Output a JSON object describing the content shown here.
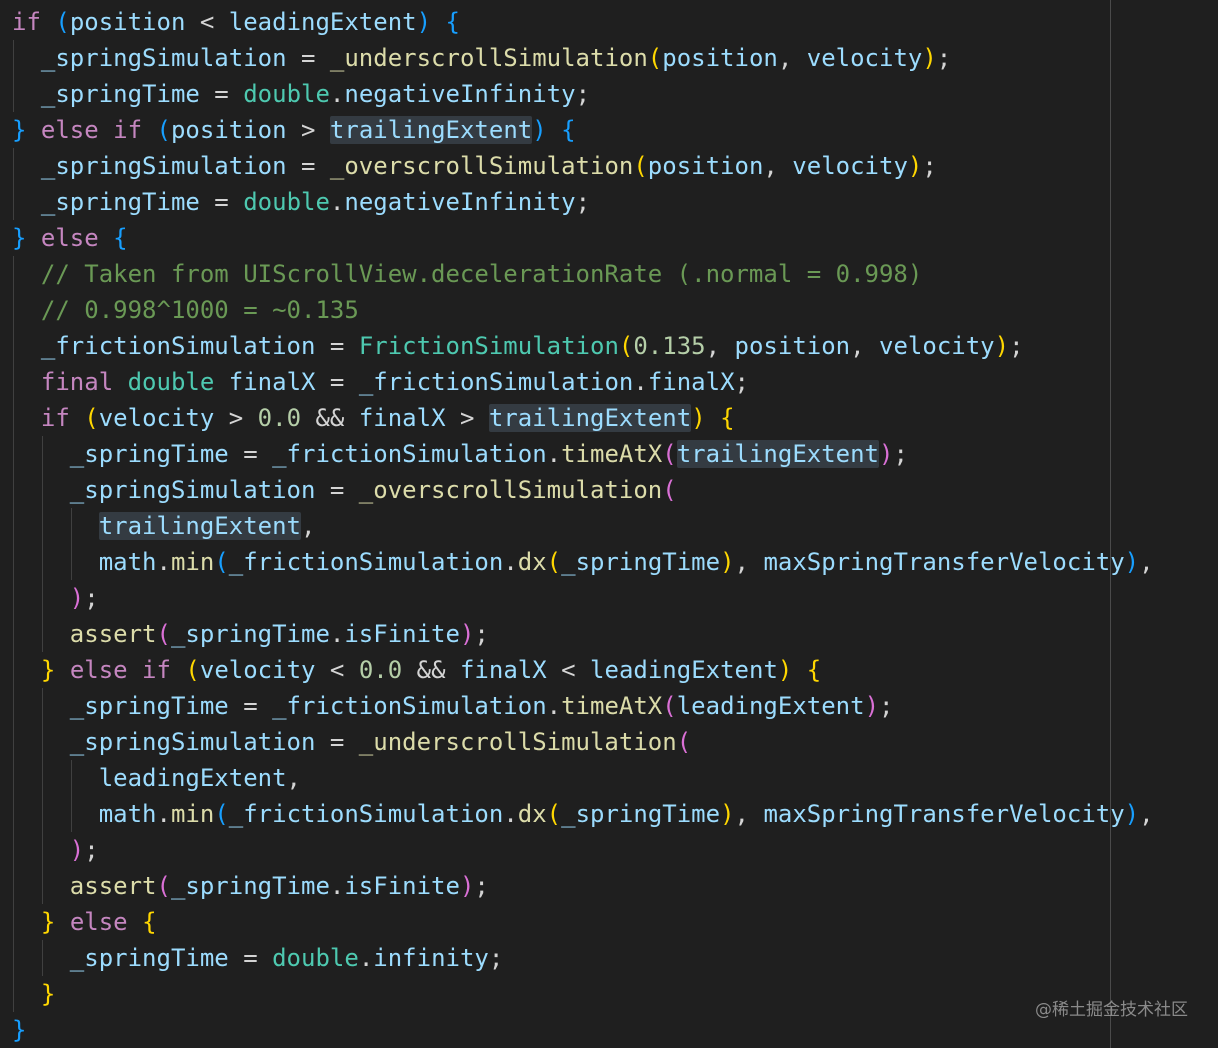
{
  "editor": {
    "indent_unit": "  ",
    "lines": [
      {
        "indent": 0,
        "tokens": [
          [
            "keyword",
            "if"
          ],
          [
            "plain",
            " "
          ],
          [
            "bracket3",
            "("
          ],
          [
            "var",
            "position"
          ],
          [
            "plain",
            " < "
          ],
          [
            "var",
            "leadingExtent"
          ],
          [
            "bracket3",
            ")"
          ],
          [
            "plain",
            " "
          ],
          [
            "bracket3",
            "{"
          ]
        ]
      },
      {
        "indent": 1,
        "tokens": [
          [
            "var",
            "_springSimulation"
          ],
          [
            "plain",
            " = "
          ],
          [
            "func",
            "_underscrollSimulation"
          ],
          [
            "bracket1",
            "("
          ],
          [
            "var",
            "position"
          ],
          [
            "plain",
            ", "
          ],
          [
            "var",
            "velocity"
          ],
          [
            "bracket1",
            ")"
          ],
          [
            "plain",
            ";"
          ]
        ]
      },
      {
        "indent": 1,
        "tokens": [
          [
            "var",
            "_springTime"
          ],
          [
            "plain",
            " = "
          ],
          [
            "type",
            "double"
          ],
          [
            "plain",
            "."
          ],
          [
            "var",
            "negativeInfinity"
          ],
          [
            "plain",
            ";"
          ]
        ]
      },
      {
        "indent": 0,
        "tokens": [
          [
            "bracket3",
            "}"
          ],
          [
            "plain",
            " "
          ],
          [
            "keyword",
            "else if"
          ],
          [
            "plain",
            " "
          ],
          [
            "bracket3",
            "("
          ],
          [
            "var",
            "position"
          ],
          [
            "plain",
            " > "
          ],
          [
            "var",
            "trailingExtent",
            "hl"
          ],
          [
            "bracket3",
            ")"
          ],
          [
            "plain",
            " "
          ],
          [
            "bracket3",
            "{"
          ]
        ]
      },
      {
        "indent": 1,
        "tokens": [
          [
            "var",
            "_springSimulation"
          ],
          [
            "plain",
            " = "
          ],
          [
            "func",
            "_overscrollSimulation"
          ],
          [
            "bracket1",
            "("
          ],
          [
            "var",
            "position"
          ],
          [
            "plain",
            ", "
          ],
          [
            "var",
            "velocity"
          ],
          [
            "bracket1",
            ")"
          ],
          [
            "plain",
            ";"
          ]
        ]
      },
      {
        "indent": 1,
        "tokens": [
          [
            "var",
            "_springTime"
          ],
          [
            "plain",
            " = "
          ],
          [
            "type",
            "double"
          ],
          [
            "plain",
            "."
          ],
          [
            "var",
            "negativeInfinity"
          ],
          [
            "plain",
            ";"
          ]
        ]
      },
      {
        "indent": 0,
        "tokens": [
          [
            "bracket3",
            "}"
          ],
          [
            "plain",
            " "
          ],
          [
            "keyword",
            "else"
          ],
          [
            "plain",
            " "
          ],
          [
            "bracket3",
            "{"
          ]
        ]
      },
      {
        "indent": 1,
        "tokens": [
          [
            "comment",
            "// Taken from UIScrollView.decelerationRate (.normal = 0.998)"
          ]
        ]
      },
      {
        "indent": 1,
        "tokens": [
          [
            "comment",
            "// 0.998^1000 = ~0.135"
          ]
        ]
      },
      {
        "indent": 1,
        "tokens": [
          [
            "var",
            "_frictionSimulation"
          ],
          [
            "plain",
            " = "
          ],
          [
            "type",
            "FrictionSimulation"
          ],
          [
            "bracket1",
            "("
          ],
          [
            "num",
            "0.135"
          ],
          [
            "plain",
            ", "
          ],
          [
            "var",
            "position"
          ],
          [
            "plain",
            ", "
          ],
          [
            "var",
            "velocity"
          ],
          [
            "bracket1",
            ")"
          ],
          [
            "plain",
            ";"
          ]
        ]
      },
      {
        "indent": 1,
        "tokens": [
          [
            "keyword",
            "final"
          ],
          [
            "plain",
            " "
          ],
          [
            "type",
            "double"
          ],
          [
            "plain",
            " "
          ],
          [
            "var",
            "finalX"
          ],
          [
            "plain",
            " = "
          ],
          [
            "var",
            "_frictionSimulation"
          ],
          [
            "plain",
            "."
          ],
          [
            "var",
            "finalX"
          ],
          [
            "plain",
            ";"
          ]
        ]
      },
      {
        "indent": 1,
        "tokens": [
          [
            "keyword",
            "if"
          ],
          [
            "plain",
            " "
          ],
          [
            "bracket1",
            "("
          ],
          [
            "var",
            "velocity"
          ],
          [
            "plain",
            " > "
          ],
          [
            "num",
            "0.0"
          ],
          [
            "plain",
            " && "
          ],
          [
            "var",
            "finalX"
          ],
          [
            "plain",
            " > "
          ],
          [
            "var",
            "trailingExtent",
            "hl"
          ],
          [
            "bracket1",
            ")"
          ],
          [
            "plain",
            " "
          ],
          [
            "bracket1",
            "{"
          ]
        ]
      },
      {
        "indent": 2,
        "tokens": [
          [
            "var",
            "_springTime"
          ],
          [
            "plain",
            " = "
          ],
          [
            "var",
            "_frictionSimulation"
          ],
          [
            "plain",
            "."
          ],
          [
            "func",
            "timeAtX"
          ],
          [
            "bracket2",
            "("
          ],
          [
            "var",
            "trailingExtent",
            "hl"
          ],
          [
            "bracket2",
            ")"
          ],
          [
            "plain",
            ";"
          ]
        ]
      },
      {
        "indent": 2,
        "tokens": [
          [
            "var",
            "_springSimulation"
          ],
          [
            "plain",
            " = "
          ],
          [
            "func",
            "_overscrollSimulation"
          ],
          [
            "bracket2",
            "("
          ]
        ]
      },
      {
        "indent": 3,
        "tokens": [
          [
            "var",
            "trailingExtent",
            "hl"
          ],
          [
            "plain",
            ","
          ]
        ]
      },
      {
        "indent": 3,
        "tokens": [
          [
            "var",
            "math"
          ],
          [
            "plain",
            "."
          ],
          [
            "func",
            "min"
          ],
          [
            "bracket3",
            "("
          ],
          [
            "var",
            "_frictionSimulation"
          ],
          [
            "plain",
            "."
          ],
          [
            "func",
            "dx"
          ],
          [
            "bracket1",
            "("
          ],
          [
            "var",
            "_springTime"
          ],
          [
            "bracket1",
            ")"
          ],
          [
            "plain",
            ", "
          ],
          [
            "var",
            "maxSpringTransferVelocity"
          ],
          [
            "bracket3",
            ")"
          ],
          [
            "plain",
            ","
          ]
        ]
      },
      {
        "indent": 2,
        "tokens": [
          [
            "bracket2",
            ")"
          ],
          [
            "plain",
            ";"
          ]
        ]
      },
      {
        "indent": 2,
        "tokens": [
          [
            "func",
            "assert"
          ],
          [
            "bracket2",
            "("
          ],
          [
            "var",
            "_springTime"
          ],
          [
            "plain",
            "."
          ],
          [
            "var",
            "isFinite"
          ],
          [
            "bracket2",
            ")"
          ],
          [
            "plain",
            ";"
          ]
        ]
      },
      {
        "indent": 1,
        "tokens": [
          [
            "bracket1",
            "}"
          ],
          [
            "plain",
            " "
          ],
          [
            "keyword",
            "else if"
          ],
          [
            "plain",
            " "
          ],
          [
            "bracket1",
            "("
          ],
          [
            "var",
            "velocity"
          ],
          [
            "plain",
            " < "
          ],
          [
            "num",
            "0.0"
          ],
          [
            "plain",
            " && "
          ],
          [
            "var",
            "finalX"
          ],
          [
            "plain",
            " < "
          ],
          [
            "var",
            "leadingExtent"
          ],
          [
            "bracket1",
            ")"
          ],
          [
            "plain",
            " "
          ],
          [
            "bracket1",
            "{"
          ]
        ]
      },
      {
        "indent": 2,
        "tokens": [
          [
            "var",
            "_springTime"
          ],
          [
            "plain",
            " = "
          ],
          [
            "var",
            "_frictionSimulation"
          ],
          [
            "plain",
            "."
          ],
          [
            "func",
            "timeAtX"
          ],
          [
            "bracket2",
            "("
          ],
          [
            "var",
            "leadingExtent"
          ],
          [
            "bracket2",
            ")"
          ],
          [
            "plain",
            ";"
          ]
        ]
      },
      {
        "indent": 2,
        "tokens": [
          [
            "var",
            "_springSimulation"
          ],
          [
            "plain",
            " = "
          ],
          [
            "func",
            "_underscrollSimulation"
          ],
          [
            "bracket2",
            "("
          ]
        ]
      },
      {
        "indent": 3,
        "tokens": [
          [
            "var",
            "leadingExtent"
          ],
          [
            "plain",
            ","
          ]
        ]
      },
      {
        "indent": 3,
        "tokens": [
          [
            "var",
            "math"
          ],
          [
            "plain",
            "."
          ],
          [
            "func",
            "min"
          ],
          [
            "bracket3",
            "("
          ],
          [
            "var",
            "_frictionSimulation"
          ],
          [
            "plain",
            "."
          ],
          [
            "func",
            "dx"
          ],
          [
            "bracket1",
            "("
          ],
          [
            "var",
            "_springTime"
          ],
          [
            "bracket1",
            ")"
          ],
          [
            "plain",
            ", "
          ],
          [
            "var",
            "maxSpringTransferVelocity"
          ],
          [
            "bracket3",
            ")"
          ],
          [
            "plain",
            ","
          ]
        ]
      },
      {
        "indent": 2,
        "tokens": [
          [
            "bracket2",
            ")"
          ],
          [
            "plain",
            ";"
          ]
        ]
      },
      {
        "indent": 2,
        "tokens": [
          [
            "func",
            "assert"
          ],
          [
            "bracket2",
            "("
          ],
          [
            "var",
            "_springTime"
          ],
          [
            "plain",
            "."
          ],
          [
            "var",
            "isFinite"
          ],
          [
            "bracket2",
            ")"
          ],
          [
            "plain",
            ";"
          ]
        ]
      },
      {
        "indent": 1,
        "tokens": [
          [
            "bracket1",
            "}"
          ],
          [
            "plain",
            " "
          ],
          [
            "keyword",
            "else"
          ],
          [
            "plain",
            " "
          ],
          [
            "bracket1",
            "{"
          ]
        ]
      },
      {
        "indent": 2,
        "tokens": [
          [
            "var",
            "_springTime"
          ],
          [
            "plain",
            " = "
          ],
          [
            "type",
            "double"
          ],
          [
            "plain",
            "."
          ],
          [
            "var",
            "infinity"
          ],
          [
            "plain",
            ";"
          ]
        ]
      },
      {
        "indent": 1,
        "tokens": [
          [
            "bracket1",
            "}"
          ]
        ]
      },
      {
        "indent": 0,
        "tokens": [
          [
            "bracket3",
            "}"
          ]
        ]
      }
    ]
  },
  "watermark": "@稀土掘金技术社区"
}
